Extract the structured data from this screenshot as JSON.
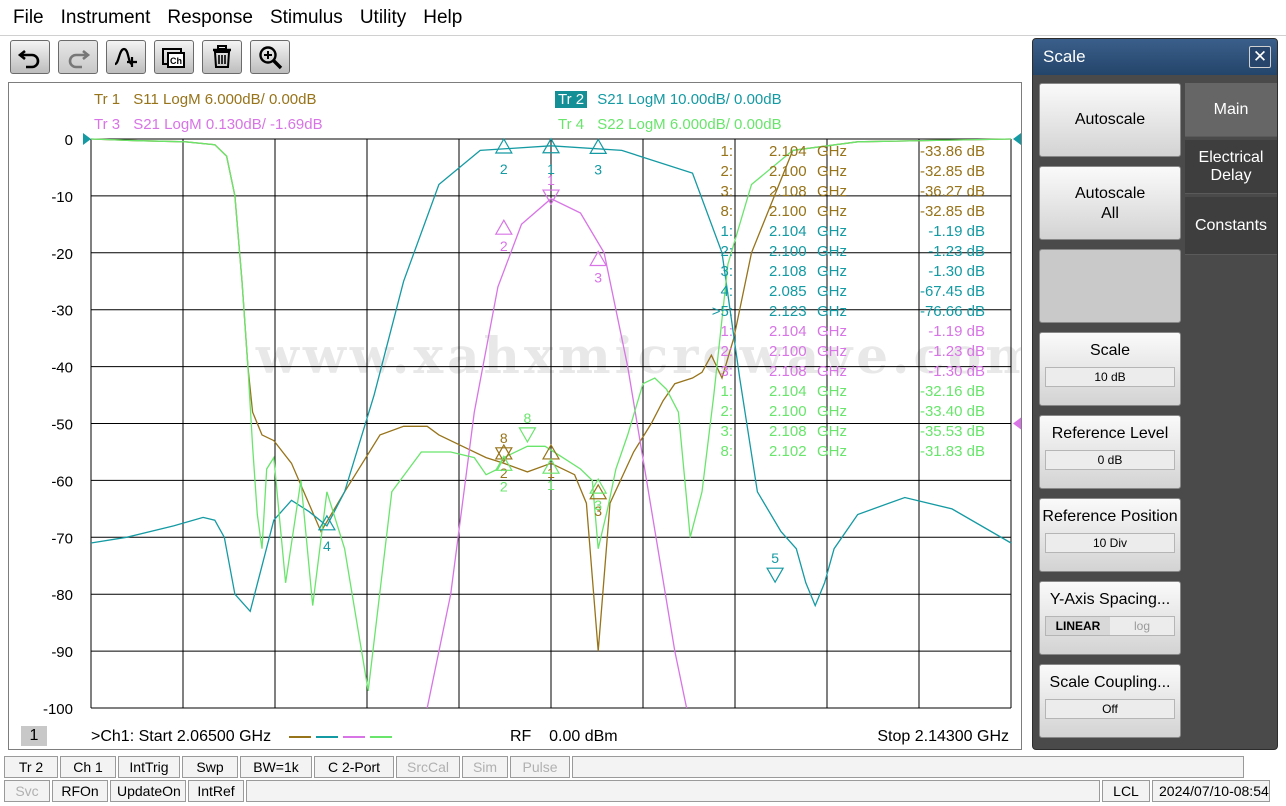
{
  "menu": [
    "File",
    "Instrument",
    "Response",
    "Stimulus",
    "Utility",
    "Help"
  ],
  "toolbar_icons": [
    "undo-icon",
    "redo-icon",
    "add-marker-icon",
    "copy-channel-icon",
    "delete-icon",
    "zoom-icon"
  ],
  "traces": [
    {
      "id": "Tr 1",
      "desc": "S11 LogM 6.000dB/  0.00dB",
      "color": "#97731a"
    },
    {
      "id": "Tr 2",
      "desc": "S21 LogM 10.00dB/  0.00dB",
      "color": "#149aa3"
    },
    {
      "id": "Tr 3",
      "desc": "S21 LogM 0.130dB/  -1.69dB",
      "color": "#d874e6"
    },
    {
      "id": "Tr 4",
      "desc": "S22 LogM 6.000dB/  0.00dB",
      "color": "#69e56c"
    }
  ],
  "markers": [
    {
      "id": "1:",
      "freq": "2.104",
      "unit": "GHz",
      "value": "-33.86 dB",
      "trace": 0
    },
    {
      "id": "2:",
      "freq": "2.100",
      "unit": "GHz",
      "value": "-32.85 dB",
      "trace": 0
    },
    {
      "id": "3:",
      "freq": "2.108",
      "unit": "GHz",
      "value": "-36.27 dB",
      "trace": 0
    },
    {
      "id": "8:",
      "freq": "2.100",
      "unit": "GHz",
      "value": "-32.85 dB",
      "trace": 0
    },
    {
      "id": "1:",
      "freq": "2.104",
      "unit": "GHz",
      "value": "-1.19 dB",
      "trace": 1
    },
    {
      "id": "2:",
      "freq": "2.100",
      "unit": "GHz",
      "value": "-1.23 dB",
      "trace": 1
    },
    {
      "id": "3:",
      "freq": "2.108",
      "unit": "GHz",
      "value": "-1.30 dB",
      "trace": 1
    },
    {
      "id": "4:",
      "freq": "2.085",
      "unit": "GHz",
      "value": "-67.45 dB",
      "trace": 1
    },
    {
      "id": ">5:",
      "freq": "2.123",
      "unit": "GHz",
      "value": "-76.66 dB",
      "trace": 1
    },
    {
      "id": "1:",
      "freq": "2.104",
      "unit": "GHz",
      "value": "-1.19 dB",
      "trace": 2
    },
    {
      "id": "2:",
      "freq": "2.100",
      "unit": "GHz",
      "value": "-1.23 dB",
      "trace": 2
    },
    {
      "id": "3:",
      "freq": "2.108",
      "unit": "GHz",
      "value": "-1.30 dB",
      "trace": 2
    },
    {
      "id": "1:",
      "freq": "2.104",
      "unit": "GHz",
      "value": "-32.16 dB",
      "trace": 3
    },
    {
      "id": "2:",
      "freq": "2.100",
      "unit": "GHz",
      "value": "-33.40 dB",
      "trace": 3
    },
    {
      "id": "3:",
      "freq": "2.108",
      "unit": "GHz",
      "value": "-35.53 dB",
      "trace": 3
    },
    {
      "id": "8:",
      "freq": "2.102",
      "unit": "GHz",
      "value": "-31.83 dB",
      "trace": 3
    }
  ],
  "yticks": [
    "0",
    "-10",
    "-20",
    "-30",
    "-40",
    "-50",
    "-60",
    "-70",
    "-80",
    "-90",
    "-100"
  ],
  "watermark": "www.xahxmicrowave.com",
  "footer": {
    "channel_num": "1",
    "start": ">Ch1:  Start  2.06500 GHz",
    "rf": "RF    0.00 dBm",
    "stop": "Stop  2.14300 GHz"
  },
  "chart_data": {
    "type": "line",
    "xlabel": "",
    "ylabel": "",
    "xlim": [
      2.065,
      2.143
    ],
    "ylim": [
      -100,
      0
    ],
    "grid": true,
    "series": [
      {
        "name": "Tr 1 S11",
        "color": "#97731a",
        "x": [
          2.065,
          2.069,
          2.073,
          2.0755,
          2.0765,
          2.0772,
          2.0778,
          2.0783,
          2.0787,
          2.0795,
          2.0805,
          2.082,
          2.0845,
          2.0865,
          2.0895,
          2.0915,
          2.0935,
          2.0945,
          2.0965,
          2.0985,
          2.1,
          2.102,
          2.104,
          2.106,
          2.107,
          2.108,
          2.109,
          2.111,
          2.1125,
          2.1135,
          2.1145,
          2.116,
          2.1168,
          2.1176,
          2.1185,
          2.1195,
          2.121,
          2.1245,
          2.13,
          2.143
        ],
        "y": [
          0,
          -0.3,
          -0.5,
          -1,
          -3,
          -10,
          -25,
          -40,
          -48,
          -52,
          -53,
          -57,
          -69,
          -62,
          -52,
          -50.5,
          -50.5,
          -52,
          -54,
          -56,
          -57,
          -58.5,
          -57,
          -59,
          -64,
          -90,
          -64,
          -55,
          -50,
          -46,
          -43,
          -42,
          -41,
          -38,
          -42,
          -35,
          -20,
          -2,
          -0.5,
          0
        ]
      },
      {
        "name": "Tr 2 S21",
        "color": "#149aa3",
        "x": [
          2.065,
          2.068,
          2.072,
          2.0745,
          2.0755,
          2.0763,
          2.0772,
          2.0785,
          2.0795,
          2.0805,
          2.082,
          2.0835,
          2.085,
          2.0865,
          2.089,
          2.0915,
          2.0945,
          2.098,
          2.104,
          2.11,
          2.116,
          2.1185,
          2.12,
          2.1215,
          2.1235,
          2.1248,
          2.1256,
          2.1264,
          2.1272,
          2.128,
          2.13,
          2.134,
          2.138,
          2.143
        ],
        "y": [
          -71,
          -70,
          -68,
          -66.5,
          -67,
          -70,
          -80,
          -83,
          -75,
          -67,
          -63.5,
          -65.5,
          -68,
          -62,
          -45,
          -25,
          -8,
          -2,
          -1.2,
          -2,
          -6,
          -20,
          -42,
          -62,
          -69,
          -72,
          -78,
          -82,
          -78,
          -72,
          -66,
          -63,
          -65,
          -71
        ]
      },
      {
        "name": "Tr 3 S21",
        "color": "#d874e6",
        "x": [
          2.0935,
          2.0955,
          2.0975,
          2.0995,
          2.1015,
          2.104,
          2.1065,
          2.1085,
          2.1105,
          2.1125,
          2.1145,
          2.1155
        ],
        "y": [
          -100,
          -80,
          -48,
          -26,
          -15,
          -10.5,
          -13,
          -20,
          -40,
          -65,
          -90,
          -100
        ]
      },
      {
        "name": "Tr 4 S22",
        "color": "#69e56c",
        "x": [
          2.065,
          2.069,
          2.073,
          2.0755,
          2.0765,
          2.0772,
          2.0778,
          2.0783,
          2.0787,
          2.0791,
          2.0795,
          2.0799,
          2.0805,
          2.0815,
          2.0828,
          2.0838,
          2.085,
          2.0865,
          2.0885,
          2.0905,
          2.093,
          2.0955,
          2.0975,
          2.0985,
          2.0995,
          2.1,
          2.102,
          2.1035,
          2.105,
          2.1065,
          2.1075,
          2.108,
          2.1088,
          2.1095,
          2.1105,
          2.1118,
          2.1128,
          2.1138,
          2.1148,
          2.1158,
          2.1168,
          2.1178,
          2.119,
          2.121,
          2.1245,
          2.13,
          2.143
        ],
        "y": [
          0,
          -0.3,
          -0.5,
          -1,
          -3,
          -10,
          -25,
          -40,
          -54,
          -66,
          -72,
          -58,
          -56,
          -78,
          -60,
          -82,
          -62,
          -72,
          -97,
          -62,
          -55,
          -55,
          -56,
          -59,
          -58,
          -56,
          -54,
          -54,
          -56,
          -58,
          -60,
          -72,
          -65,
          -58,
          -52,
          -43,
          -42,
          -44,
          -48,
          -70,
          -62,
          -45,
          -22,
          -8,
          -2,
          -0.5,
          0
        ]
      }
    ]
  },
  "panel": {
    "title": "Scale",
    "close": "✕",
    "tabs": [
      "Main",
      "Electrical Delay",
      "Constants"
    ],
    "autoscale": "Autoscale",
    "autoscale_all": "Autoscale All",
    "scale_label": "Scale",
    "scale_value": "10 dB",
    "ref_level_label": "Reference Level",
    "ref_level_value": "0 dB",
    "ref_pos_label": "Reference Position",
    "ref_pos_value": "10 Div",
    "yaxis_label": "Y-Axis Spacing...",
    "yaxis_linear": "LINEAR",
    "yaxis_log": "log",
    "coupling_label": "Scale Coupling...",
    "coupling_value": "Off"
  },
  "status1": [
    {
      "label": "Tr 2",
      "enabled": true,
      "width": 54
    },
    {
      "label": "Ch 1",
      "enabled": true,
      "width": 56
    },
    {
      "label": "IntTrig",
      "enabled": true,
      "width": 62
    },
    {
      "label": "Swp",
      "enabled": true,
      "width": 56
    },
    {
      "label": "BW=1k",
      "enabled": true,
      "width": 72
    },
    {
      "label": "C  2-Port",
      "enabled": true,
      "width": 80
    },
    {
      "label": "SrcCal",
      "enabled": false,
      "width": 64
    },
    {
      "label": "Sim",
      "enabled": false,
      "width": 46
    },
    {
      "label": "Pulse",
      "enabled": false,
      "width": 60
    },
    {
      "label": "",
      "enabled": true,
      "width": 672
    }
  ],
  "status2": [
    {
      "label": "Svc",
      "enabled": false,
      "width": 46
    },
    {
      "label": "RFOn",
      "enabled": true,
      "width": 56
    },
    {
      "label": "UpdateOn",
      "enabled": true,
      "width": 76
    },
    {
      "label": "IntRef",
      "enabled": true,
      "width": 56
    },
    {
      "label": "",
      "enabled": true,
      "width": 854
    },
    {
      "label": "LCL",
      "enabled": true,
      "width": 48
    },
    {
      "label": "2024/07/10-08:54",
      "enabled": true,
      "width": 118
    }
  ]
}
